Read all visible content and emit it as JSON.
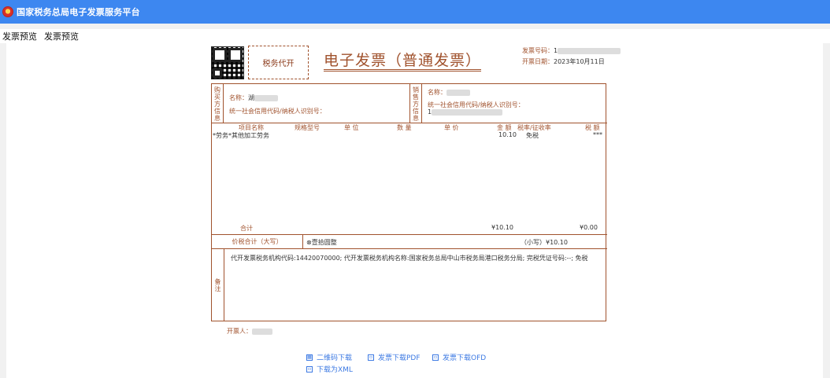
{
  "topbar": {
    "title": "国家税务总局电子发票服务平台",
    "icon": "tax-emblem-icon"
  },
  "tabs": [
    "发票预览",
    "发票预览"
  ],
  "invoice": {
    "stamp": "税务代开",
    "title": "电子发票（普通发票）",
    "number_label": "发票号码：",
    "number_value": "1",
    "date_label": "开票日期：",
    "date_value": "2023年10月11日",
    "buyer": {
      "label": "购买方信息",
      "name_label": "名称：",
      "name_value": "湖",
      "tax_id_label": "统一社会信用代码/纳税人识别号："
    },
    "seller": {
      "label": "销售方信息",
      "name_label": "名称：",
      "tax_id_label": "统一社会信用代码/纳税人识别号：",
      "tax_id_value": "1"
    },
    "headers": {
      "item": "项目名称",
      "spec": "规格型号",
      "unit": "单 位",
      "qty": "数 量",
      "price": "单 价",
      "amount": "金 额",
      "rate": "税率/征收率",
      "tax": "税 额"
    },
    "items": [
      {
        "name": "*劳务*其他加工劳务",
        "amount": "10.10",
        "rate": "免税",
        "tax": "***"
      }
    ],
    "total_label": "合计",
    "total_amount": "¥10.10",
    "total_tax": "¥0.00",
    "tax_total_label": "价税合计（大写）",
    "tax_total_upper": "⊗壹拾圆整",
    "tax_total_lower": "（小写）¥10.10",
    "remark_label": "备注",
    "remark_text": "代开发票税务机构代码:14420070000; 代开发票税务机构名称:国家税务总局中山市税务局港口税务分局; 完税凭证号码:--; 免税",
    "issuer_label": "开票人："
  },
  "downloads": [
    {
      "label": "二维码下载",
      "icon": "qrcode-icon"
    },
    {
      "label": "发票下载PDF",
      "icon": "pdf-icon"
    },
    {
      "label": "发票下载OFD",
      "icon": "ofd-icon"
    },
    {
      "label": "下载为XML",
      "icon": "xml-icon"
    }
  ]
}
